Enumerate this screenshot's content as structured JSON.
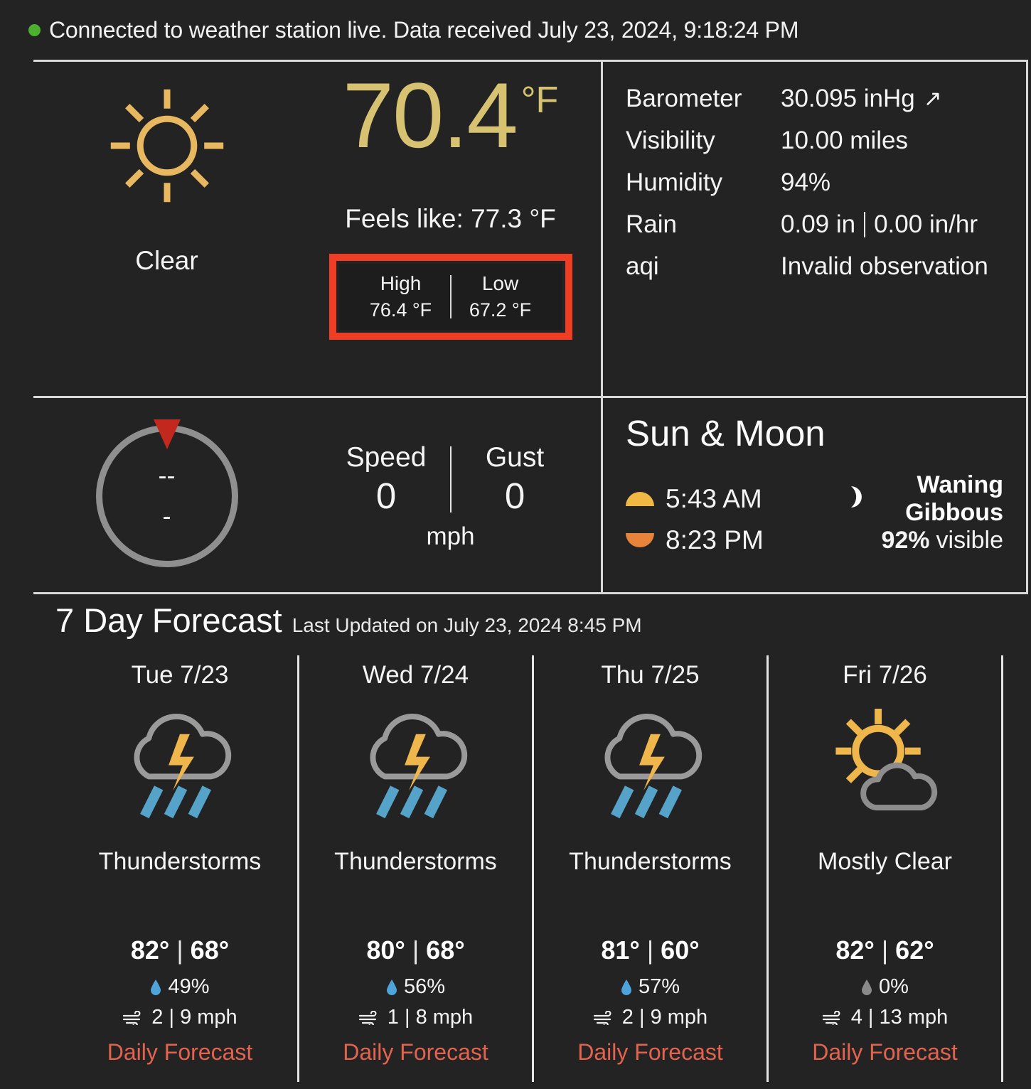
{
  "status": {
    "dot_color": "#4CAF2E",
    "text": "Connected to weather station live. Data received July 23, 2024, 9:18:24 PM"
  },
  "current": {
    "icon": "sun-icon",
    "condition": "Clear",
    "temperature": "70.4",
    "unit": "°F",
    "feels_like": "Feels like: 77.3 °F",
    "high_label": "High",
    "high_value": "76.4 °F",
    "low_label": "Low",
    "low_value": "67.2 °F",
    "highlight_color": "#F03E24",
    "accent_color": "#d6c271"
  },
  "observations": [
    {
      "key": "Barometer",
      "value": "30.095 inHg",
      "trend": "↗"
    },
    {
      "key": "Visibility",
      "value": "10.00 miles",
      "trend": ""
    },
    {
      "key": "Humidity",
      "value": "94%",
      "trend": ""
    },
    {
      "key": "Rain",
      "value": "0.09 in",
      "value2": "0.00 in/hr",
      "trend": ""
    },
    {
      "key": "aqi",
      "value": "Invalid observation",
      "trend": ""
    }
  ],
  "wind": {
    "direction": "--",
    "degrees": "-",
    "speed_label": "Speed",
    "speed_value": "0",
    "gust_label": "Gust",
    "gust_value": "0",
    "unit": "mph",
    "needle_color": "#C3281E",
    "ring_color": "#8f8f8f"
  },
  "sun_moon": {
    "title": "Sun & Moon",
    "sunrise": "5:43 AM",
    "sunset": "8:23 PM",
    "moon_phase": "Waning Gibbous",
    "moon_glyph": "◐",
    "visible_pct": "92%",
    "visible_label": "visible"
  },
  "forecast": {
    "title": "7 Day Forecast",
    "last_updated": "Last Updated on July 23, 2024 8:45 PM",
    "link_label": "Daily Forecast",
    "link_color": "#E4634F",
    "days": [
      {
        "day": "Tue 7/23",
        "icon": "thunderstorm-icon",
        "condition": "Thunderstorms",
        "high": "82°",
        "low": "68°",
        "precip": "49%",
        "precip_active": true,
        "wind": "2 | 9 mph",
        "link": "Daily Forecast"
      },
      {
        "day": "Wed 7/24",
        "icon": "thunderstorm-icon",
        "condition": "Thunderstorms",
        "high": "80°",
        "low": "68°",
        "precip": "56%",
        "precip_active": true,
        "wind": "1 | 8 mph",
        "link": "Daily Forecast"
      },
      {
        "day": "Thu 7/25",
        "icon": "thunderstorm-icon",
        "condition": "Thunderstorms",
        "high": "81°",
        "low": "60°",
        "precip": "57%",
        "precip_active": true,
        "wind": "2 | 9 mph",
        "link": "Daily Forecast"
      },
      {
        "day": "Fri 7/26",
        "icon": "sun-cloud-icon",
        "condition": "Mostly Clear",
        "high": "82°",
        "low": "62°",
        "precip": "0%",
        "precip_active": false,
        "wind": "4 | 13 mph",
        "link": "Daily Forecast"
      }
    ]
  }
}
